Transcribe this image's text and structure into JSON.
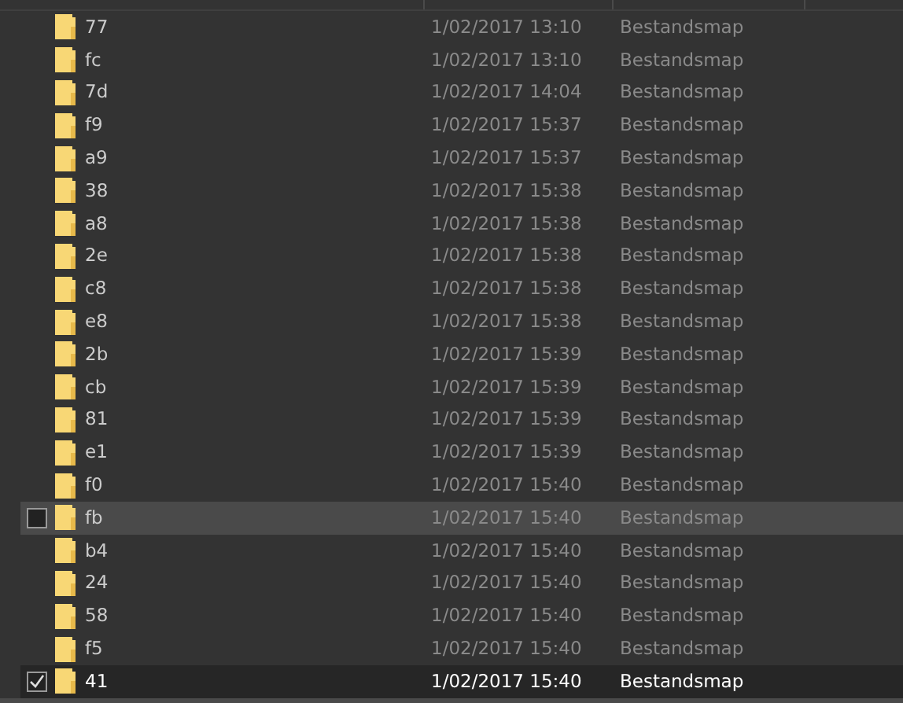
{
  "rows": [
    {
      "name": "77",
      "date": "1/02/2017 13:10",
      "type": "Bestandsmap",
      "hovered": false,
      "selected": false
    },
    {
      "name": "fc",
      "date": "1/02/2017 13:10",
      "type": "Bestandsmap",
      "hovered": false,
      "selected": false
    },
    {
      "name": "7d",
      "date": "1/02/2017 14:04",
      "type": "Bestandsmap",
      "hovered": false,
      "selected": false
    },
    {
      "name": "f9",
      "date": "1/02/2017 15:37",
      "type": "Bestandsmap",
      "hovered": false,
      "selected": false
    },
    {
      "name": "a9",
      "date": "1/02/2017 15:37",
      "type": "Bestandsmap",
      "hovered": false,
      "selected": false
    },
    {
      "name": "38",
      "date": "1/02/2017 15:38",
      "type": "Bestandsmap",
      "hovered": false,
      "selected": false
    },
    {
      "name": "a8",
      "date": "1/02/2017 15:38",
      "type": "Bestandsmap",
      "hovered": false,
      "selected": false
    },
    {
      "name": "2e",
      "date": "1/02/2017 15:38",
      "type": "Bestandsmap",
      "hovered": false,
      "selected": false
    },
    {
      "name": "c8",
      "date": "1/02/2017 15:38",
      "type": "Bestandsmap",
      "hovered": false,
      "selected": false
    },
    {
      "name": "e8",
      "date": "1/02/2017 15:38",
      "type": "Bestandsmap",
      "hovered": false,
      "selected": false
    },
    {
      "name": "2b",
      "date": "1/02/2017 15:39",
      "type": "Bestandsmap",
      "hovered": false,
      "selected": false
    },
    {
      "name": "cb",
      "date": "1/02/2017 15:39",
      "type": "Bestandsmap",
      "hovered": false,
      "selected": false
    },
    {
      "name": "81",
      "date": "1/02/2017 15:39",
      "type": "Bestandsmap",
      "hovered": false,
      "selected": false
    },
    {
      "name": "e1",
      "date": "1/02/2017 15:39",
      "type": "Bestandsmap",
      "hovered": false,
      "selected": false
    },
    {
      "name": "f0",
      "date": "1/02/2017 15:40",
      "type": "Bestandsmap",
      "hovered": false,
      "selected": false
    },
    {
      "name": "fb",
      "date": "1/02/2017 15:40",
      "type": "Bestandsmap",
      "hovered": true,
      "selected": false
    },
    {
      "name": "b4",
      "date": "1/02/2017 15:40",
      "type": "Bestandsmap",
      "hovered": false,
      "selected": false
    },
    {
      "name": "24",
      "date": "1/02/2017 15:40",
      "type": "Bestandsmap",
      "hovered": false,
      "selected": false
    },
    {
      "name": "58",
      "date": "1/02/2017 15:40",
      "type": "Bestandsmap",
      "hovered": false,
      "selected": false
    },
    {
      "name": "f5",
      "date": "1/02/2017 15:40",
      "type": "Bestandsmap",
      "hovered": false,
      "selected": false
    },
    {
      "name": "41",
      "date": "1/02/2017 15:40",
      "type": "Bestandsmap",
      "hovered": false,
      "selected": true
    }
  ]
}
